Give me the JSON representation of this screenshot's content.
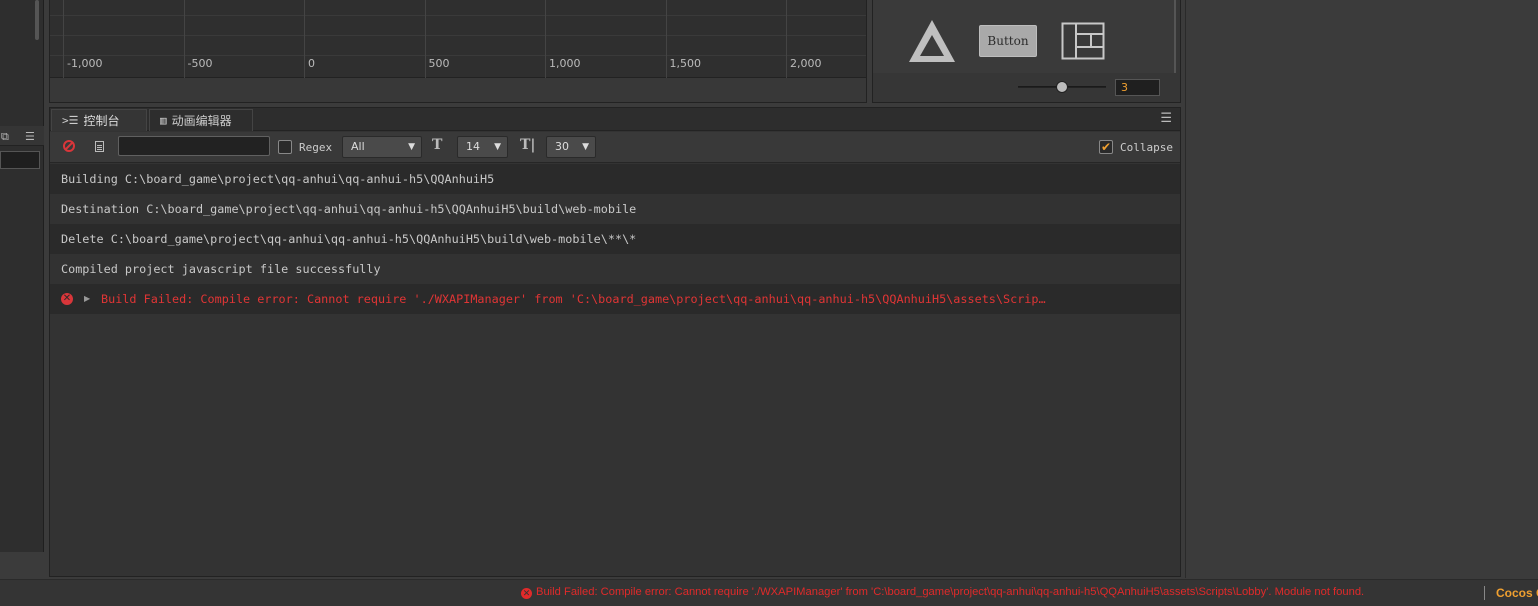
{
  "left_panel": {
    "header_icons": [
      "restore-icon",
      "menu-icon"
    ]
  },
  "timeline_ruler": {
    "ticks": [
      "-1,000",
      "-500",
      "0",
      "500",
      "1,000",
      "1,500",
      "2,000"
    ]
  },
  "widgets": {
    "button_label": "Button",
    "slider_value": "3",
    "slider_level": 0.5
  },
  "console": {
    "tabs": [
      {
        "label": "控制台",
        "icon": "console-icon"
      },
      {
        "label": "动画编辑器",
        "icon": "animation-icon"
      }
    ],
    "toolbar": {
      "search_value": "",
      "regex_label": "Regex",
      "regex_checked": false,
      "level_value": "All",
      "font_size_value": "14",
      "line_count_value": "30",
      "collapse_label": "Collapse",
      "collapse_checked": true
    },
    "logs": [
      {
        "type": "info",
        "text": "Building C:\\board_game\\project\\qq-anhui\\qq-anhui-h5\\QQAnhuiH5"
      },
      {
        "type": "info",
        "text": "Destination C:\\board_game\\project\\qq-anhui\\qq-anhui-h5\\QQAnhuiH5\\build\\web-mobile"
      },
      {
        "type": "info",
        "text": "Delete C:\\board_game\\project\\qq-anhui\\qq-anhui-h5\\QQAnhuiH5\\build\\web-mobile\\**\\*"
      },
      {
        "type": "info",
        "text": "Compiled project javascript file successfully"
      },
      {
        "type": "error",
        "text": "Build Failed: Compile error: Cannot require './WXAPIManager' from 'C:\\board_game\\project\\qq-anhui\\qq-anhui-h5\\QQAnhuiH5\\assets\\Scrip…"
      }
    ]
  },
  "status_bar": {
    "message": "Build Failed: Compile error: Cannot require './WXAPIManager' from 'C:\\board_game\\project\\qq-anhui\\qq-anhui-h5\\QQAnhuiH5\\assets\\Scripts\\Lobby'. Module not found.",
    "brand": "Cocos C",
    "error_color": "#e02a2a",
    "accent_color": "#f0a030"
  }
}
